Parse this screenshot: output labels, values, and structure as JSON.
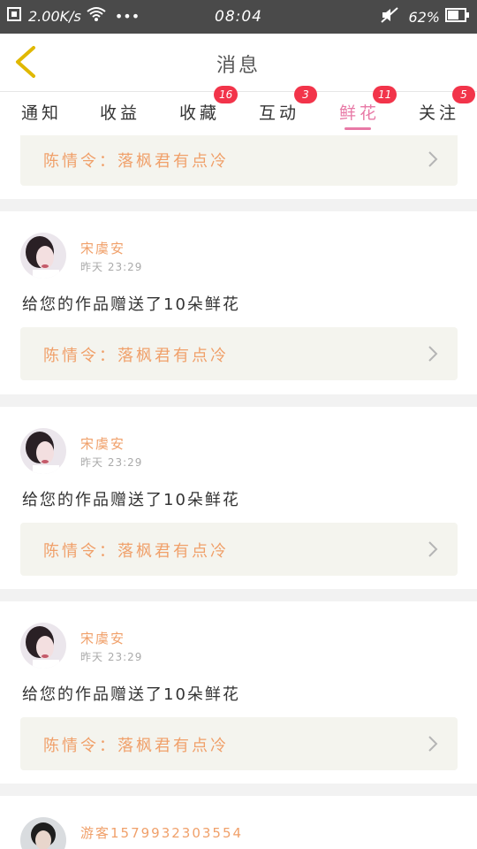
{
  "status_bar": {
    "speed": "2.00K/s",
    "dots": "•••",
    "time": "08:04",
    "battery": "62%"
  },
  "header": {
    "title": "消息"
  },
  "tabs": [
    {
      "label": "通知",
      "badge": ""
    },
    {
      "label": "收益",
      "badge": ""
    },
    {
      "label": "收藏",
      "badge": "16"
    },
    {
      "label": "互动",
      "badge": "3"
    },
    {
      "label": "鲜花",
      "badge": "11"
    },
    {
      "label": "关注",
      "badge": "5"
    }
  ],
  "active_tab": "鲜花",
  "colors": {
    "accent_pink": "#e879a6",
    "badge_red": "#f2344a",
    "orange_text": "#f0a06a"
  },
  "messages": [
    {
      "card_text": "陈情令：落枫君有点冷"
    },
    {
      "name": "宋虞安",
      "time": "昨天 23:29",
      "text": "给您的作品赠送了10朵鲜花",
      "card_text": "陈情令：落枫君有点冷"
    },
    {
      "name": "宋虞安",
      "time": "昨天 23:29",
      "text": "给您的作品赠送了10朵鲜花",
      "card_text": "陈情令：落枫君有点冷"
    },
    {
      "name": "宋虞安",
      "time": "昨天 23:29",
      "text": "给您的作品赠送了10朵鲜花",
      "card_text": "陈情令：落枫君有点冷"
    },
    {
      "name": "游客1579932303554"
    }
  ]
}
